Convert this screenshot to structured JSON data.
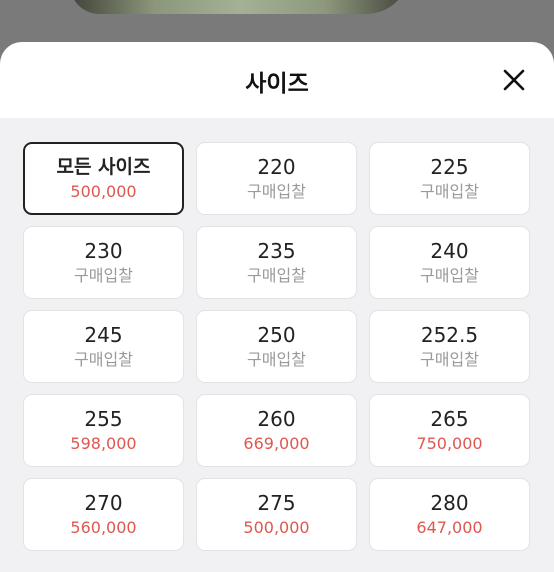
{
  "sheet": {
    "title": "사이즈",
    "close_icon": "close-icon"
  },
  "colors": {
    "price_red": "#e0574f",
    "bid_gray": "#9a9a9a",
    "selected_border": "#222222"
  },
  "sizes": [
    {
      "size": "모든 사이즈",
      "price": "500,000",
      "style": "red",
      "selected": true
    },
    {
      "size": "220",
      "price": "구매입찰",
      "style": "bid"
    },
    {
      "size": "225",
      "price": "구매입찰",
      "style": "bid"
    },
    {
      "size": "230",
      "price": "구매입찰",
      "style": "bid"
    },
    {
      "size": "235",
      "price": "구매입찰",
      "style": "bid"
    },
    {
      "size": "240",
      "price": "구매입찰",
      "style": "bid"
    },
    {
      "size": "245",
      "price": "구매입찰",
      "style": "bid"
    },
    {
      "size": "250",
      "price": "구매입찰",
      "style": "bid"
    },
    {
      "size": "252.5",
      "price": "구매입찰",
      "style": "bid"
    },
    {
      "size": "255",
      "price": "598,000",
      "style": "red"
    },
    {
      "size": "260",
      "price": "669,000",
      "style": "red"
    },
    {
      "size": "265",
      "price": "750,000",
      "style": "red"
    },
    {
      "size": "270",
      "price": "560,000",
      "style": "red"
    },
    {
      "size": "275",
      "price": "500,000",
      "style": "red"
    },
    {
      "size": "280",
      "price": "647,000",
      "style": "red"
    }
  ]
}
